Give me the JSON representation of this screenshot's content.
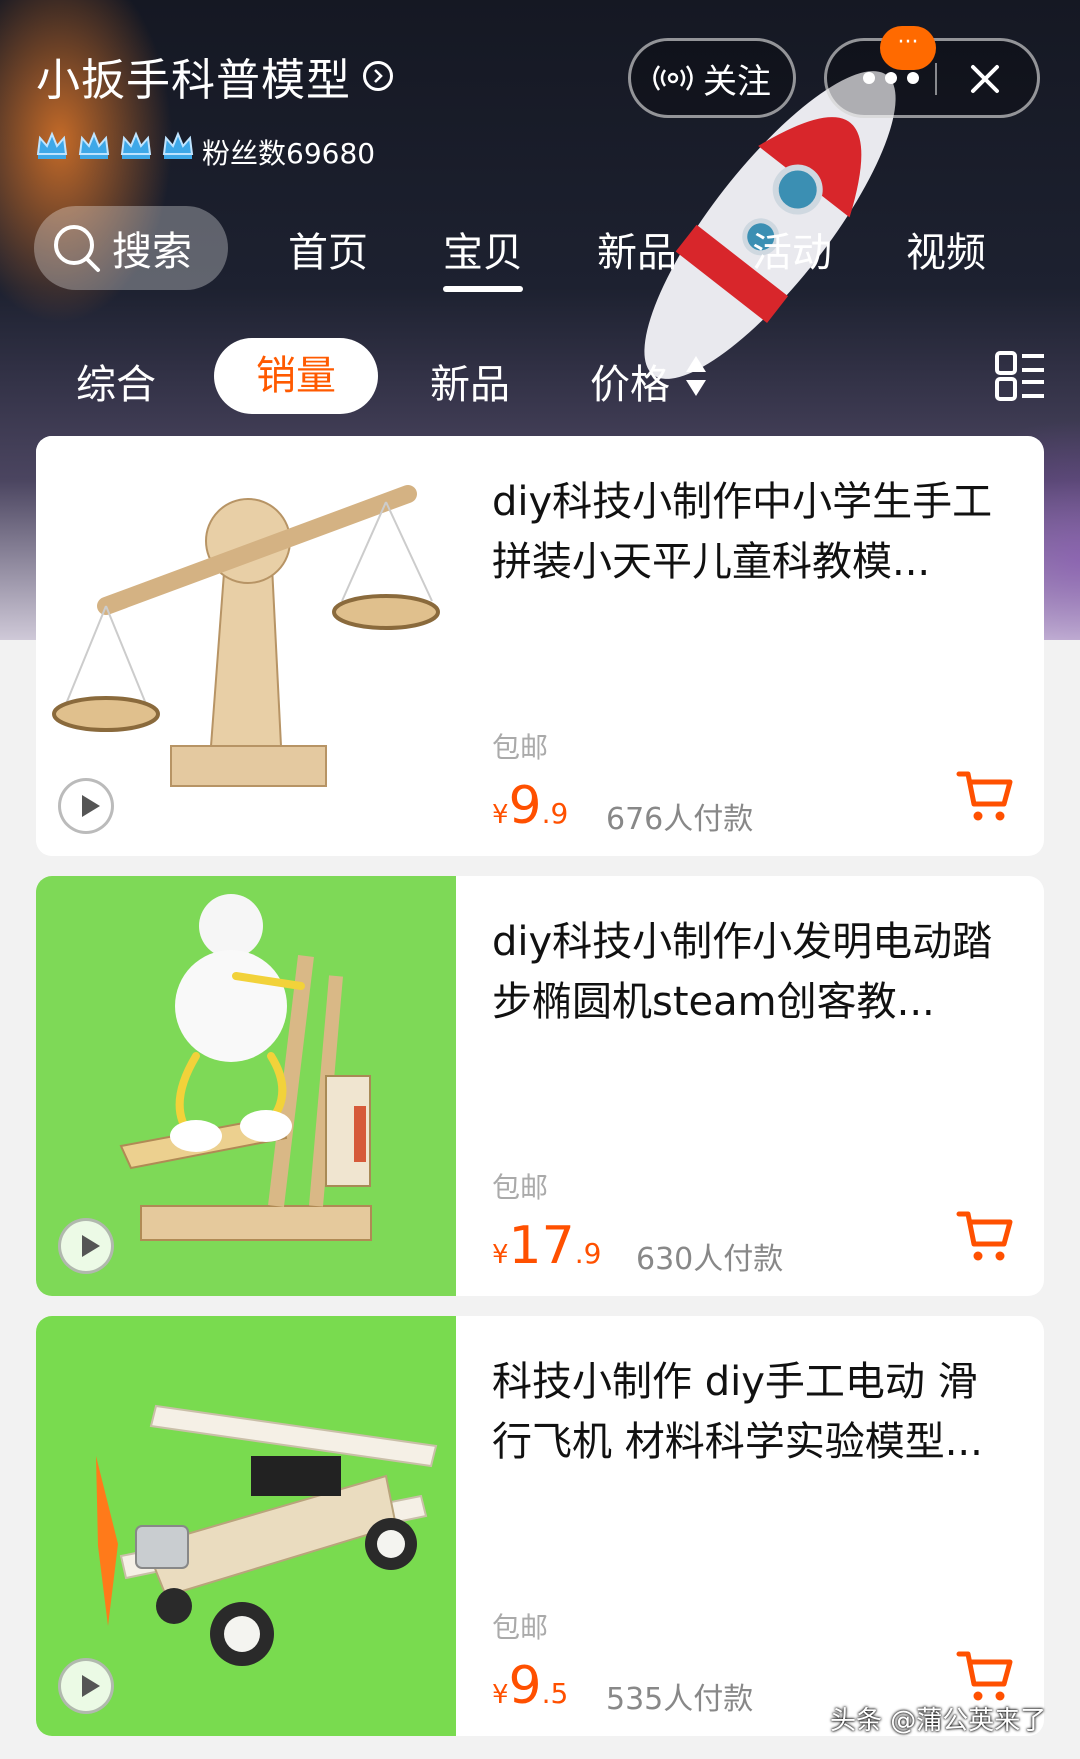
{
  "shop": {
    "name": "小扳手科普模型",
    "fans": "粉丝数69680",
    "crown_count": 4,
    "follow_label": "关注",
    "badge": "···"
  },
  "nav": {
    "search_label": "搜索",
    "tabs": [
      "首页",
      "宝贝",
      "新品",
      "活动",
      "视频"
    ],
    "active_tab": "宝贝"
  },
  "sort": {
    "items": [
      "综合",
      "销量",
      "新品",
      "价格"
    ],
    "active": "销量"
  },
  "products": [
    {
      "title": "diy科技小制作中小学生手工拼装小天平儿童科教模...",
      "shipping": "包邮",
      "currency": "¥",
      "price_int": "9",
      "price_dec": ".9",
      "sold": "676人付款"
    },
    {
      "title": "diy科技小制作小发明电动踏步椭圆机steam创客教...",
      "shipping": "包邮",
      "currency": "¥",
      "price_int": "17",
      "price_dec": ".9",
      "sold": "630人付款"
    },
    {
      "title": "科技小制作 diy手工电动 滑行飞机 材料科学实验模型...",
      "shipping": "包邮",
      "currency": "¥",
      "price_int": "9",
      "price_dec": ".5",
      "sold": "535人付款"
    }
  ],
  "watermark": "头条 @蒲公英来了",
  "colors": {
    "accent": "#ff5000",
    "product2_bg": "#7ed957",
    "product3_bg": "#79db4f"
  },
  "icons": [
    "chevron-right-circle-icon",
    "crown-icon",
    "broadcast-icon",
    "more-dots-icon",
    "close-icon",
    "search-icon",
    "sort-arrows-icon",
    "view-toggle-icon",
    "play-icon",
    "cart-icon"
  ]
}
